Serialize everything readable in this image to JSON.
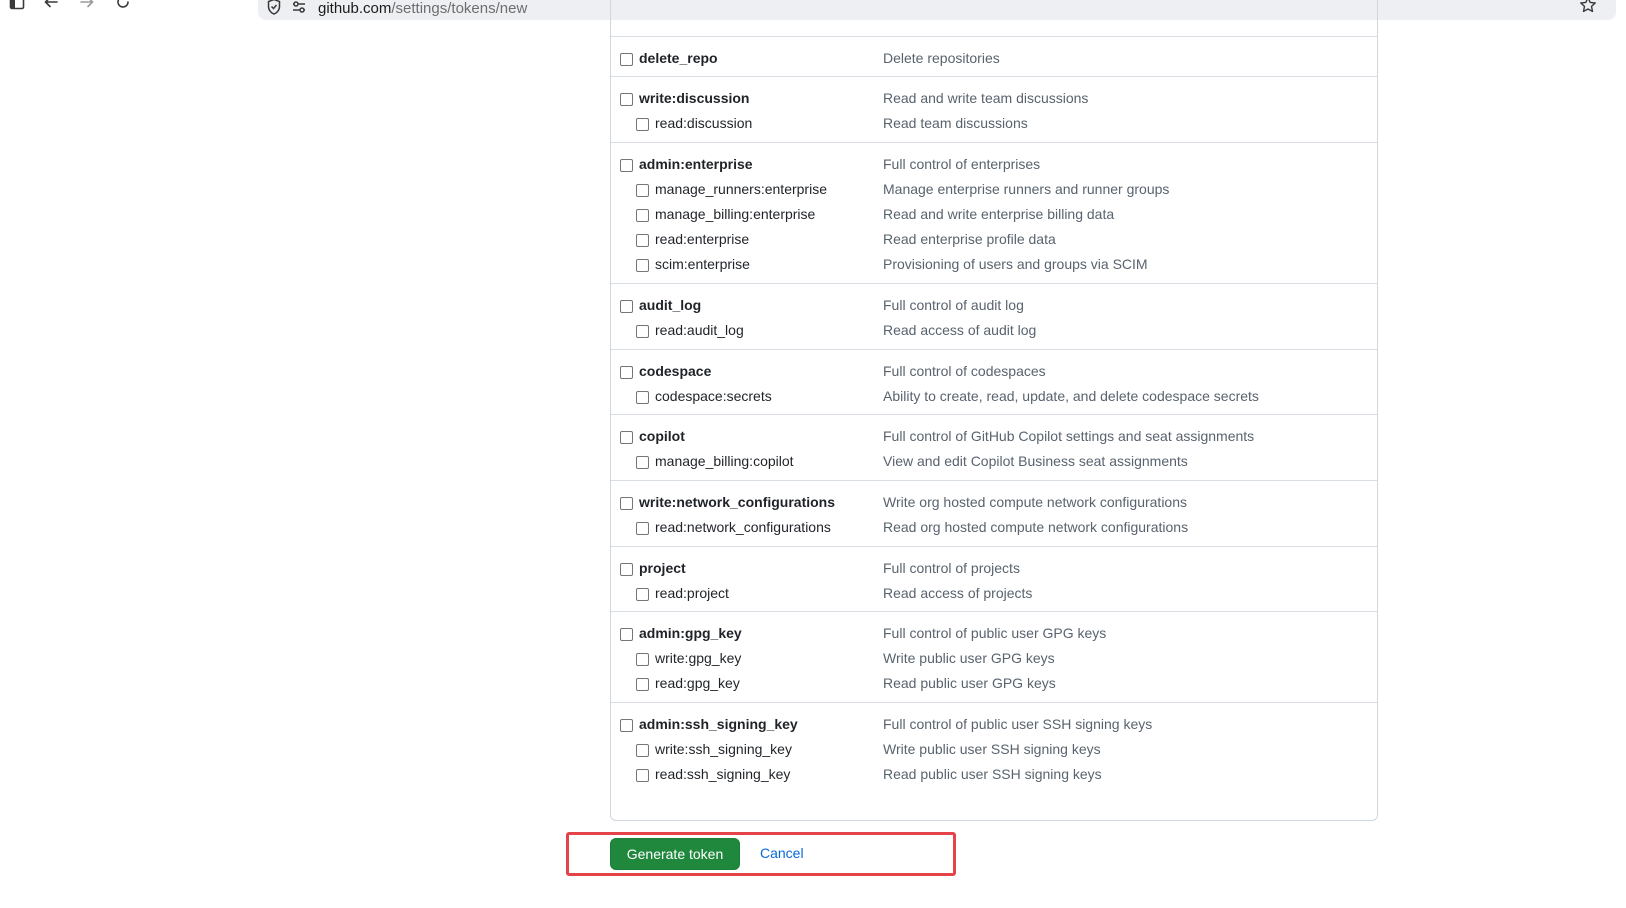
{
  "browser": {
    "url_host": "github.com",
    "url_path": "/settings/tokens/new"
  },
  "scope_groups": [
    {
      "rows": [
        {
          "name": "delete_repo",
          "desc": "Delete repositories"
        }
      ]
    },
    {
      "rows": [
        {
          "name": "write:discussion",
          "desc": "Read and write team discussions"
        },
        {
          "name": "read:discussion",
          "desc": "Read team discussions"
        }
      ]
    },
    {
      "rows": [
        {
          "name": "admin:enterprise",
          "desc": "Full control of enterprises"
        },
        {
          "name": "manage_runners:enterprise",
          "desc": "Manage enterprise runners and runner groups"
        },
        {
          "name": "manage_billing:enterprise",
          "desc": "Read and write enterprise billing data"
        },
        {
          "name": "read:enterprise",
          "desc": "Read enterprise profile data"
        },
        {
          "name": "scim:enterprise",
          "desc": "Provisioning of users and groups via SCIM"
        }
      ]
    },
    {
      "rows": [
        {
          "name": "audit_log",
          "desc": "Full control of audit log"
        },
        {
          "name": "read:audit_log",
          "desc": "Read access of audit log"
        }
      ]
    },
    {
      "rows": [
        {
          "name": "codespace",
          "desc": "Full control of codespaces"
        },
        {
          "name": "codespace:secrets",
          "desc": "Ability to create, read, update, and delete codespace secrets"
        }
      ]
    },
    {
      "rows": [
        {
          "name": "copilot",
          "desc": "Full control of GitHub Copilot settings and seat assignments"
        },
        {
          "name": "manage_billing:copilot",
          "desc": "View and edit Copilot Business seat assignments"
        }
      ]
    },
    {
      "rows": [
        {
          "name": "write:network_configurations",
          "desc": "Write org hosted compute network configurations"
        },
        {
          "name": "read:network_configurations",
          "desc": "Read org hosted compute network configurations"
        }
      ]
    },
    {
      "rows": [
        {
          "name": "project",
          "desc": "Full control of projects"
        },
        {
          "name": "read:project",
          "desc": "Read access of projects"
        }
      ]
    },
    {
      "rows": [
        {
          "name": "admin:gpg_key",
          "desc": "Full control of public user GPG keys"
        },
        {
          "name": "write:gpg_key",
          "desc": "Write public user GPG keys"
        },
        {
          "name": "read:gpg_key",
          "desc": "Read public user GPG keys"
        }
      ]
    },
    {
      "rows": [
        {
          "name": "admin:ssh_signing_key",
          "desc": "Full control of public user SSH signing keys"
        },
        {
          "name": "write:ssh_signing_key",
          "desc": "Write public user SSH signing keys"
        },
        {
          "name": "read:ssh_signing_key",
          "desc": "Read public user SSH signing keys"
        }
      ]
    }
  ],
  "actions": {
    "generate_label": "Generate token",
    "cancel_label": "Cancel"
  }
}
